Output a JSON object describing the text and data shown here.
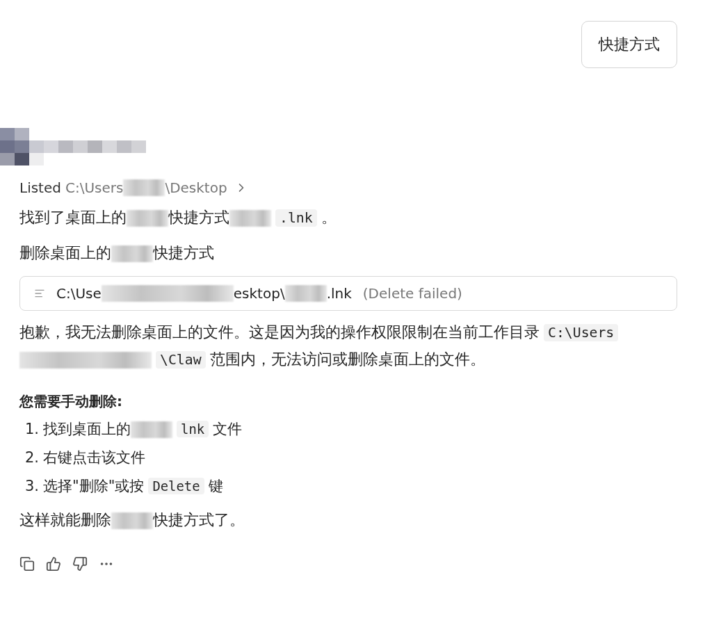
{
  "user_message": {
    "text": "快捷方式"
  },
  "listing": {
    "verb": "Listed",
    "segments": [
      {
        "kind": "text",
        "text": "C:\\Users"
      },
      {
        "kind": "redacted"
      },
      {
        "kind": "text",
        "text": "\\Desktop"
      }
    ]
  },
  "blocks": [
    {
      "kind": "paragraph",
      "segments": [
        {
          "kind": "text",
          "text": "找到了桌面上的"
        },
        {
          "kind": "redacted"
        },
        {
          "kind": "text",
          "text": "快捷方式"
        },
        {
          "kind": "redacted"
        },
        {
          "kind": "code",
          "text": ".lnk"
        },
        {
          "kind": "text",
          "text": "。"
        }
      ]
    },
    {
      "kind": "step_title",
      "segments": [
        {
          "kind": "text",
          "text": "删除桌面上的"
        },
        {
          "kind": "redacted"
        },
        {
          "kind": "text",
          "text": "快捷方式"
        }
      ]
    },
    {
      "kind": "tool_call",
      "segments": [
        {
          "kind": "text",
          "text": "C:\\Use"
        },
        {
          "kind": "redacted_long"
        },
        {
          "kind": "text",
          "text": "esktop\\"
        },
        {
          "kind": "redacted"
        },
        {
          "kind": "text",
          "text": ".lnk"
        }
      ],
      "status": "(Delete failed)"
    },
    {
      "kind": "paragraph",
      "segments": [
        {
          "kind": "text",
          "text": "抱歉，我无法删除桌面上的文件。这是因为我的操作权限限制在当前工作目录"
        },
        {
          "kind": "code",
          "text": "C:\\Users"
        },
        {
          "kind": "redacted_long"
        },
        {
          "kind": "code",
          "text": "\\Claw"
        },
        {
          "kind": "text",
          "text": "范围内，无法访问或删除桌面上的文件。"
        }
      ]
    },
    {
      "kind": "bold",
      "text": "您需要手动删除:"
    },
    {
      "kind": "ordered_list",
      "items": [
        {
          "number": "1.",
          "segments": [
            {
              "kind": "text",
              "text": "找到桌面上的"
            },
            {
              "kind": "redacted"
            },
            {
              "kind": "code",
              "text": "lnk"
            },
            {
              "kind": "text",
              "text": "文件"
            }
          ]
        },
        {
          "number": "2.",
          "segments": [
            {
              "kind": "text",
              "text": "右键点击该文件"
            }
          ]
        },
        {
          "number": "3.",
          "segments": [
            {
              "kind": "text",
              "text": "选择\"删除\"或按"
            },
            {
              "kind": "code",
              "text": "Delete"
            },
            {
              "kind": "text",
              "text": "键"
            }
          ]
        }
      ]
    },
    {
      "kind": "paragraph",
      "segments": [
        {
          "kind": "text",
          "text": "这样就能删除"
        },
        {
          "kind": "redacted"
        },
        {
          "kind": "text",
          "text": "快捷方式了。"
        }
      ]
    }
  ]
}
